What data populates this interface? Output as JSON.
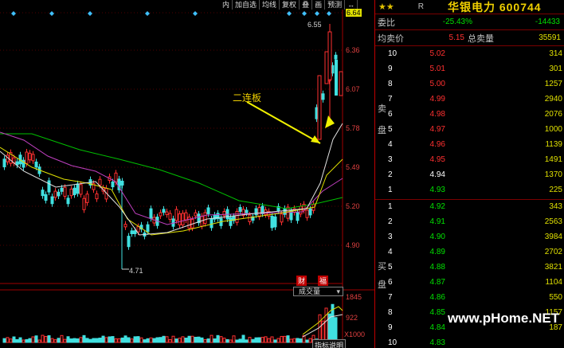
{
  "toolbar": {
    "items": [
      "内",
      "加自选",
      "均线",
      "复权",
      "叠",
      "画",
      "预测",
      "↔"
    ]
  },
  "chart": {
    "price_labels": [
      "6.64",
      "6.36",
      "6.07",
      "5.78",
      "5.49",
      "5.20",
      "4.90"
    ],
    "high_label": "6.55",
    "low_label": "4.71",
    "annotation": "二连板",
    "vol_indicator_label": "成交量",
    "vol_scale": [
      "1845",
      "922",
      "X1000"
    ],
    "finance_btn": "财",
    "info_btn": "福",
    "bottom_btn": "指标说明"
  },
  "panel": {
    "stock_name": "华银电力 600744",
    "r_label": "R",
    "weibi_label": "委比",
    "weibi_pct": "-25.43%",
    "weibi_diff": "-14433",
    "avg_label": "均卖价",
    "avg_price": "5.15",
    "total_sell_label": "总卖量",
    "total_sell": "35591",
    "sell_label_1": "卖",
    "sell_label_2": "盘",
    "buy_label_1": "买",
    "buy_label_2": "盘",
    "sell": [
      {
        "lvl": "10",
        "price": "5.02",
        "qty": "314",
        "color": "#ff3030"
      },
      {
        "lvl": "9",
        "price": "5.01",
        "qty": "301",
        "color": "#ff3030"
      },
      {
        "lvl": "8",
        "price": "5.00",
        "qty": "1257",
        "color": "#ff3030"
      },
      {
        "lvl": "7",
        "price": "4.99",
        "qty": "2940",
        "color": "#ff3030"
      },
      {
        "lvl": "6",
        "price": "4.98",
        "qty": "2076",
        "color": "#ff3030"
      },
      {
        "lvl": "5",
        "price": "4.97",
        "qty": "1000",
        "color": "#ff3030"
      },
      {
        "lvl": "4",
        "price": "4.96",
        "qty": "1139",
        "color": "#ff3030"
      },
      {
        "lvl": "3",
        "price": "4.95",
        "qty": "1491",
        "color": "#ff3030"
      },
      {
        "lvl": "2",
        "price": "4.94",
        "qty": "1370",
        "color": "#ffffff"
      },
      {
        "lvl": "1",
        "price": "4.93",
        "qty": "225",
        "color": "#00e000"
      }
    ],
    "buy": [
      {
        "lvl": "1",
        "price": "4.92",
        "qty": "343",
        "color": "#00e000"
      },
      {
        "lvl": "2",
        "price": "4.91",
        "qty": "2563",
        "color": "#00e000"
      },
      {
        "lvl": "3",
        "price": "4.90",
        "qty": "3984",
        "color": "#00e000"
      },
      {
        "lvl": "4",
        "price": "4.89",
        "qty": "2702",
        "color": "#00e000"
      },
      {
        "lvl": "5",
        "price": "4.88",
        "qty": "3821",
        "color": "#00e000"
      },
      {
        "lvl": "6",
        "price": "4.87",
        "qty": "1104",
        "color": "#00e000"
      },
      {
        "lvl": "7",
        "price": "4.86",
        "qty": "550",
        "color": "#00e000"
      },
      {
        "lvl": "8",
        "price": "4.85",
        "qty": "1157",
        "color": "#00e000"
      },
      {
        "lvl": "9",
        "price": "4.84",
        "qty": "187",
        "color": "#00e000"
      },
      {
        "lvl": "10",
        "price": "4.83",
        "qty": "",
        "color": "#00e000"
      }
    ]
  },
  "watermark": "www.pHome.NET"
}
